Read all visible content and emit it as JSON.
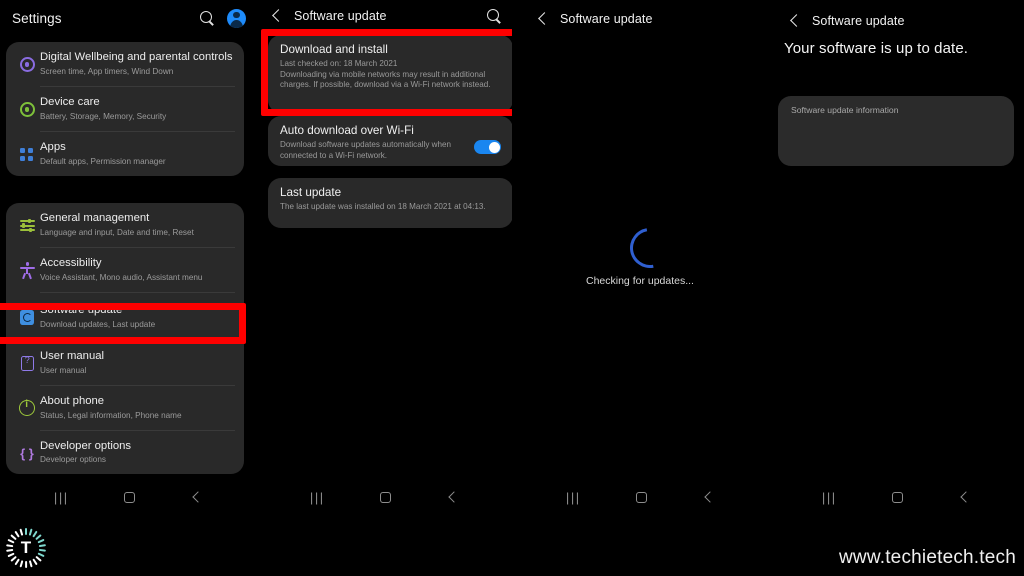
{
  "panel1": {
    "header": {
      "title": "Settings",
      "search_icon": "search-icon",
      "avatar_icon": "account-avatar-icon"
    },
    "group1": [
      {
        "title": "Digital Wellbeing and parental controls",
        "sub": "Screen time, App timers, Wind Down",
        "icon": "digital-wellbeing-icon"
      },
      {
        "title": "Device care",
        "sub": "Battery, Storage, Memory, Security",
        "icon": "device-care-icon"
      },
      {
        "title": "Apps",
        "sub": "Default apps, Permission manager",
        "icon": "apps-icon"
      }
    ],
    "group2": [
      {
        "title": "General management",
        "sub": "Language and input, Date and time, Reset",
        "icon": "general-management-icon"
      },
      {
        "title": "Accessibility",
        "sub": "Voice Assistant, Mono audio, Assistant menu",
        "icon": "accessibility-icon"
      },
      {
        "title": "Software update",
        "sub": "Download updates, Last update",
        "icon": "software-update-icon"
      },
      {
        "title": "User manual",
        "sub": "User manual",
        "icon": "user-manual-icon"
      },
      {
        "title": "About phone",
        "sub": "Status, Legal information, Phone name",
        "icon": "about-phone-icon"
      },
      {
        "title": "Developer options",
        "sub": "Developer options",
        "icon": "developer-options-icon"
      }
    ]
  },
  "panel2": {
    "header": {
      "title": "Software update",
      "back_icon": "back-chevron-icon",
      "search_icon": "search-icon"
    },
    "download_install": {
      "title": "Download and install",
      "line1": "Last checked on: 18 March 2021",
      "line2": "Downloading via mobile networks may result in additional charges. If possible, download via a Wi-Fi network instead."
    },
    "auto_download": {
      "title": "Auto download over Wi-Fi",
      "sub": "Download software updates automatically when connected to a Wi-Fi network.",
      "toggle_state": "on"
    },
    "last_update": {
      "title": "Last update",
      "sub": "The last update was installed on 18 March 2021 at 04:13."
    }
  },
  "panel3": {
    "header": {
      "title": "Software update",
      "back_icon": "back-chevron-icon"
    },
    "status_text": "Checking for updates...",
    "spinner_icon": "loading-spinner-icon"
  },
  "panel4": {
    "header": {
      "title": "Software update",
      "back_icon": "back-chevron-icon"
    },
    "headline": "Your software is up to date.",
    "info_card_label": "Software update information"
  },
  "navbar": {
    "recent_icon": "recent-apps-icon",
    "recent_glyph": "|||",
    "home_icon": "home-icon",
    "back_icon": "back-icon"
  },
  "watermark": {
    "logo_letter": "T",
    "url": "www.techietech.tech"
  },
  "colors": {
    "accent_blue": "#1a86f0",
    "highlight_red": "#fe0000",
    "card_bg": "#292929",
    "page_bg": "#000000"
  }
}
